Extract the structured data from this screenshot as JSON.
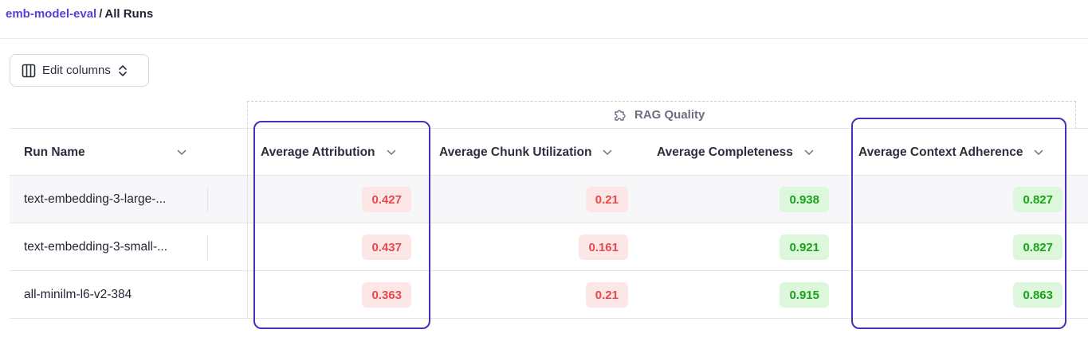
{
  "breadcrumb": {
    "project": "emb-model-eval",
    "separator": "/",
    "current": "All Runs"
  },
  "toolbar": {
    "edit_columns_label": "Edit columns"
  },
  "group": {
    "label": "RAG Quality",
    "icon": "puzzle-icon"
  },
  "columns": {
    "run_name": "Run Name",
    "attribution": "Average Attribution",
    "chunk_utilization": "Average Chunk Utilization",
    "completeness": "Average Completeness",
    "context_adherence": "Average Context Adherence"
  },
  "rows": [
    {
      "name": "text-embedding-3-large-...",
      "attribution": "0.427",
      "chunk_utilization": "0.21",
      "completeness": "0.938",
      "context_adherence": "0.827"
    },
    {
      "name": "text-embedding-3-small-...",
      "attribution": "0.437",
      "chunk_utilization": "0.161",
      "completeness": "0.921",
      "context_adherence": "0.827"
    },
    {
      "name": "all-minilm-l6-v2-384",
      "attribution": "0.363",
      "chunk_utilization": "0.21",
      "completeness": "0.915",
      "context_adherence": "0.863"
    }
  ],
  "colors": {
    "accent": "#5b3fd6",
    "highlight": "#4a2db8",
    "bad": "#e64a4a",
    "bad_bg": "#fde6e6",
    "good": "#1aa31a",
    "good_bg": "#ddf7dc"
  }
}
